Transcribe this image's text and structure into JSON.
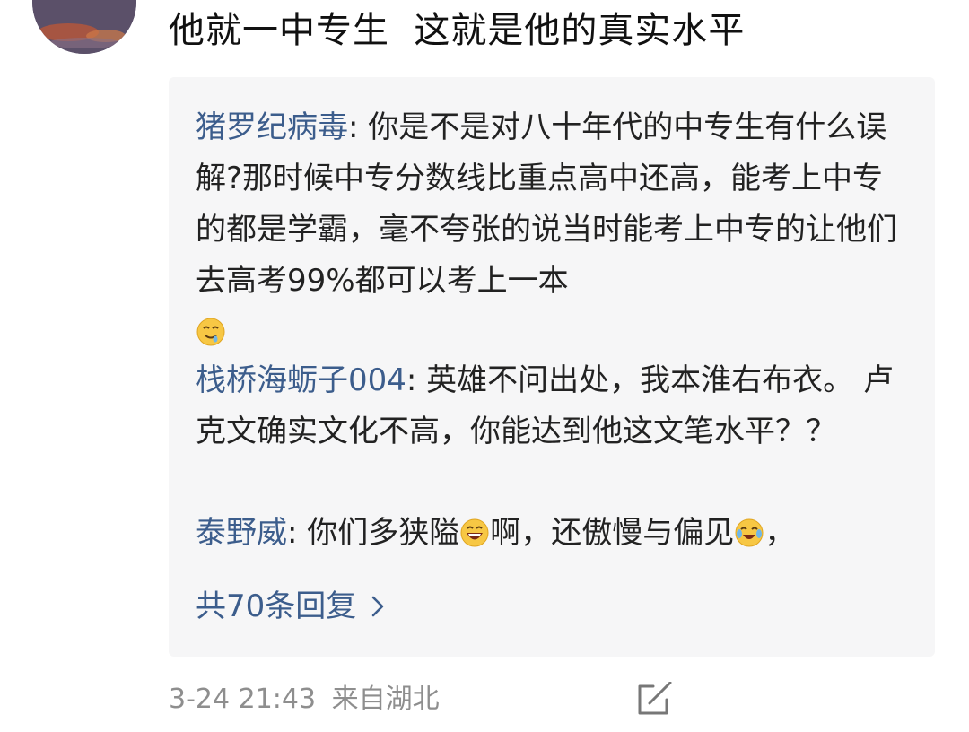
{
  "post": {
    "text": "他就一中专生  这就是他的真实水平"
  },
  "replies": [
    {
      "author": "猪罗纪病毒",
      "separator": ": ",
      "text": "你是不是对八十年代的中专生有什么误解?那时候中专分数线比重点高中还高，能考上中专的都是学霸，毫不夸张的说当时能考上中专的让他们去高考99%都可以考上一本",
      "emoji_icon": "drooling-face-emoji"
    },
    {
      "author": "栈桥海蛎子004",
      "separator": ": ",
      "text": "英雄不问出处，我本淮右布衣。 卢克文确实文化不高，你能达到他这文笔水平？？"
    },
    {
      "author": "泰野威",
      "separator": ": ",
      "text_1": "你们多狭隘",
      "emoji_1_icon": "grinning-face-emoji",
      "text_2": "啊，还傲慢与偏见",
      "emoji_2_icon": "tears-of-joy-emoji",
      "text_3": "，"
    }
  ],
  "more_replies": {
    "label": "共70条回复",
    "icon": "chevron-right-icon"
  },
  "meta": {
    "date": "3-24 21:43",
    "location": "来自湖北",
    "share_icon": "share-icon"
  }
}
